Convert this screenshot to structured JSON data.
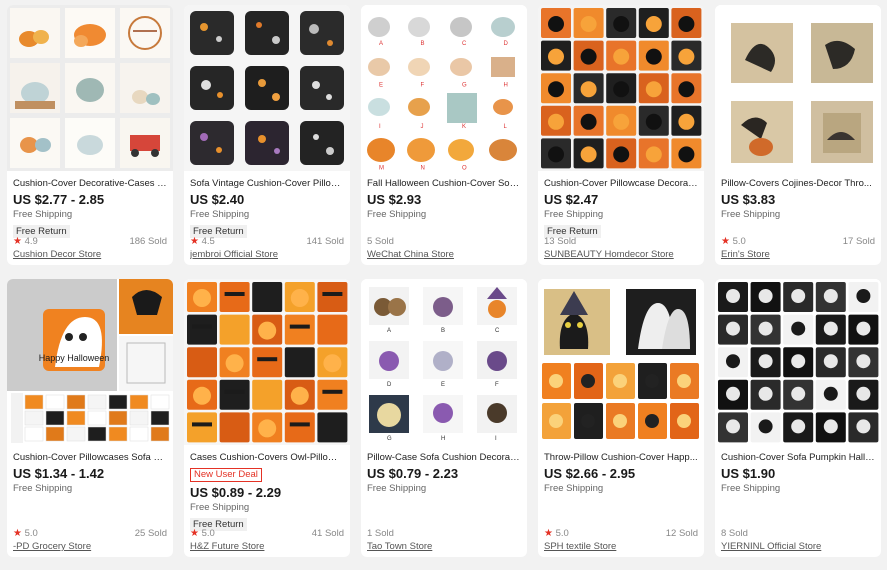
{
  "products": [
    {
      "title": "Cushion-Cover Decorative-Cases P...",
      "price": "US $2.77 - 2.85",
      "shipping": "Free Shipping",
      "free_return": "Free Return",
      "rating": "4.9",
      "sold": "186 Sold",
      "store": "Cushion Decor Store",
      "image": "pumpkin-pillows-white"
    },
    {
      "title": "Sofa Vintage Cushion-Cover Pillow-...",
      "price": "US $2.40",
      "shipping": "Free Shipping",
      "free_return": "Free Return",
      "rating": "4.5",
      "sold": "141 Sold",
      "store": "jembroi Official Store",
      "image": "halloween-pillows-black"
    },
    {
      "title": "Fall Halloween Cushion-Cover Sofa-...",
      "price": "US $2.93",
      "shipping": "Free Shipping",
      "sold": "5 Sold",
      "store": "WeChat China Store",
      "image": "pumpkin-pillows-lettered",
      "letters": [
        "A",
        "B",
        "C",
        "D",
        "E",
        "F",
        "G",
        "H",
        "I",
        "J",
        "K",
        "L",
        "M",
        "N",
        "O"
      ]
    },
    {
      "title": "Cushion-Cover Pillowcase Decorati...",
      "price": "US $2.47",
      "shipping": "Free Shipping",
      "free_return": "Free Return",
      "sold": "13 Sold",
      "store": "SUNBEAUTY Homdecor Store",
      "image": "jack-o-lantern-pillows-orange"
    },
    {
      "title": "Pillow-Covers Cojines-Decor Thro...",
      "price": "US $3.83",
      "shipping": "Free Shipping",
      "rating": "5.0",
      "sold": "17 Sold",
      "store": "Erin's Store",
      "image": "vintage-raven-pillows"
    },
    {
      "title": "Cushion-Cover Pillowcases Sofa Pu...",
      "price": "US $1.34 - 1.42",
      "shipping": "Free Shipping",
      "rating": "5.0",
      "sold": "25 Sold",
      "store": "-PD Grocery Store",
      "image": "happy-halloween-ghost-pillow",
      "pillow_text": "Happy Halloween"
    },
    {
      "title": "Cases Cushion-Covers Owl-Pillow S...",
      "price": "US $0.89 - 2.29",
      "deal": "New User Deal",
      "shipping": "Free Shipping",
      "free_return": "Free Return",
      "rating": "5.0",
      "sold": "41 Sold",
      "store": "H&Z Future Store",
      "image": "orange-pattern-pillows"
    },
    {
      "title": "Pillow-Case Sofa Cushion Decoratif...",
      "price": "US $0.79 - 2.23",
      "shipping": "Free Shipping",
      "sold": "1 Sold",
      "store": "Tao Town Store",
      "image": "owl-pillows-lettered",
      "letters": [
        "A",
        "B",
        "C",
        "D",
        "E",
        "F",
        "G",
        "H",
        "I"
      ]
    },
    {
      "title": "Throw-Pillow Cushion-Cover Happ...",
      "price": "US $2.66 - 2.95",
      "shipping": "Free Shipping",
      "rating": "5.0",
      "sold": "12 Sold",
      "store": "SPH textile Store",
      "image": "black-cat-ghost-pillows"
    },
    {
      "title": "Cushion-Cover Sofa Pumpkin Hallo...",
      "price": "US $1.90",
      "shipping": "Free Shipping",
      "sold": "8 Sold",
      "store": "YIERNINL Official Store",
      "image": "skull-pillows-black"
    }
  ],
  "colors": {
    "accent_red": "#e43225",
    "orange": "#f07a1a",
    "black": "#1c1c1c"
  }
}
